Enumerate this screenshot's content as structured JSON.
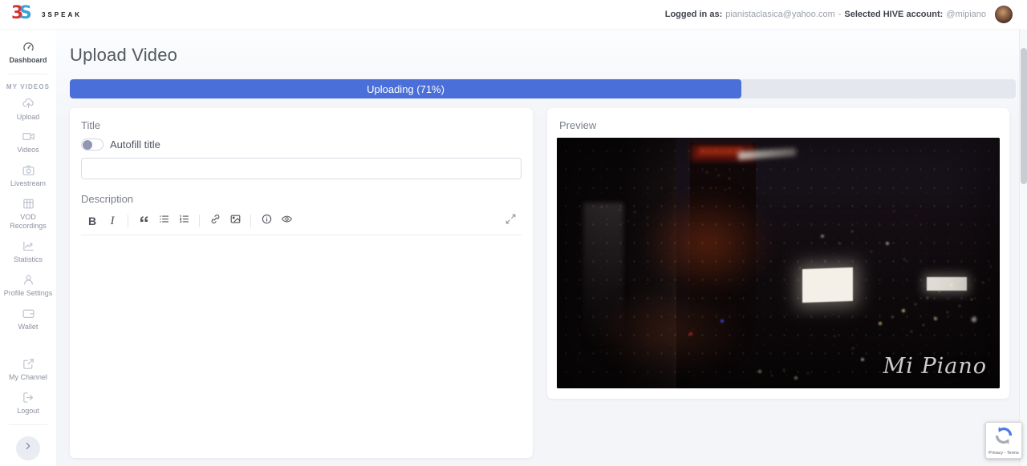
{
  "brand": {
    "mark_left": "3",
    "mark_right": "S",
    "name": "3SPEAK",
    "colors": {
      "red": "#d63333",
      "blue": "#2e9bd6"
    }
  },
  "topbar": {
    "logged_in_label": "Logged in as:",
    "email": "pianistaclasica@yahoo.com",
    "separator": "-",
    "account_label": "Selected HIVE account:",
    "account_handle": "@mipiano"
  },
  "sidebar": {
    "dashboard": {
      "label": "Dashboard",
      "icon": "dashboard-gauge-icon"
    },
    "section_label": "MY VIDEOS",
    "items": [
      {
        "label": "Upload",
        "icon": "upload-cloud-icon"
      },
      {
        "label": "Videos",
        "icon": "video-camera-icon"
      },
      {
        "label": "Livestream",
        "icon": "livestream-camera-icon"
      },
      {
        "label": "VOD Recordings",
        "icon": "vod-recordings-icon"
      },
      {
        "label": "Statistics",
        "icon": "statistics-chart-icon"
      },
      {
        "label": "Profile Settings",
        "icon": "profile-person-icon"
      },
      {
        "label": "Wallet",
        "icon": "wallet-icon"
      }
    ],
    "items_bottom": [
      {
        "label": "My Channel",
        "icon": "external-link-icon"
      },
      {
        "label": "Logout",
        "icon": "logout-icon"
      }
    ]
  },
  "main": {
    "page_title": "Upload Video",
    "progress": {
      "label": "Uploading (71%)",
      "percent": 71,
      "fill_color": "#4a6fd9",
      "track_color": "#e4e7ee"
    },
    "upload_form": {
      "title_label": "Title",
      "autofill_toggle_label": "Autofill title",
      "autofill_toggle_state": "off",
      "title_input_value": "",
      "description_label": "Description",
      "toolbar": {
        "bold": "B",
        "italic": "I"
      }
    },
    "preview": {
      "label": "Preview",
      "video_watermark": "Mi Piano"
    }
  },
  "recaptcha": {
    "privacy_terms": "Privacy - Terms",
    "blue": "#4b7bea",
    "gray": "#a6adb5"
  }
}
